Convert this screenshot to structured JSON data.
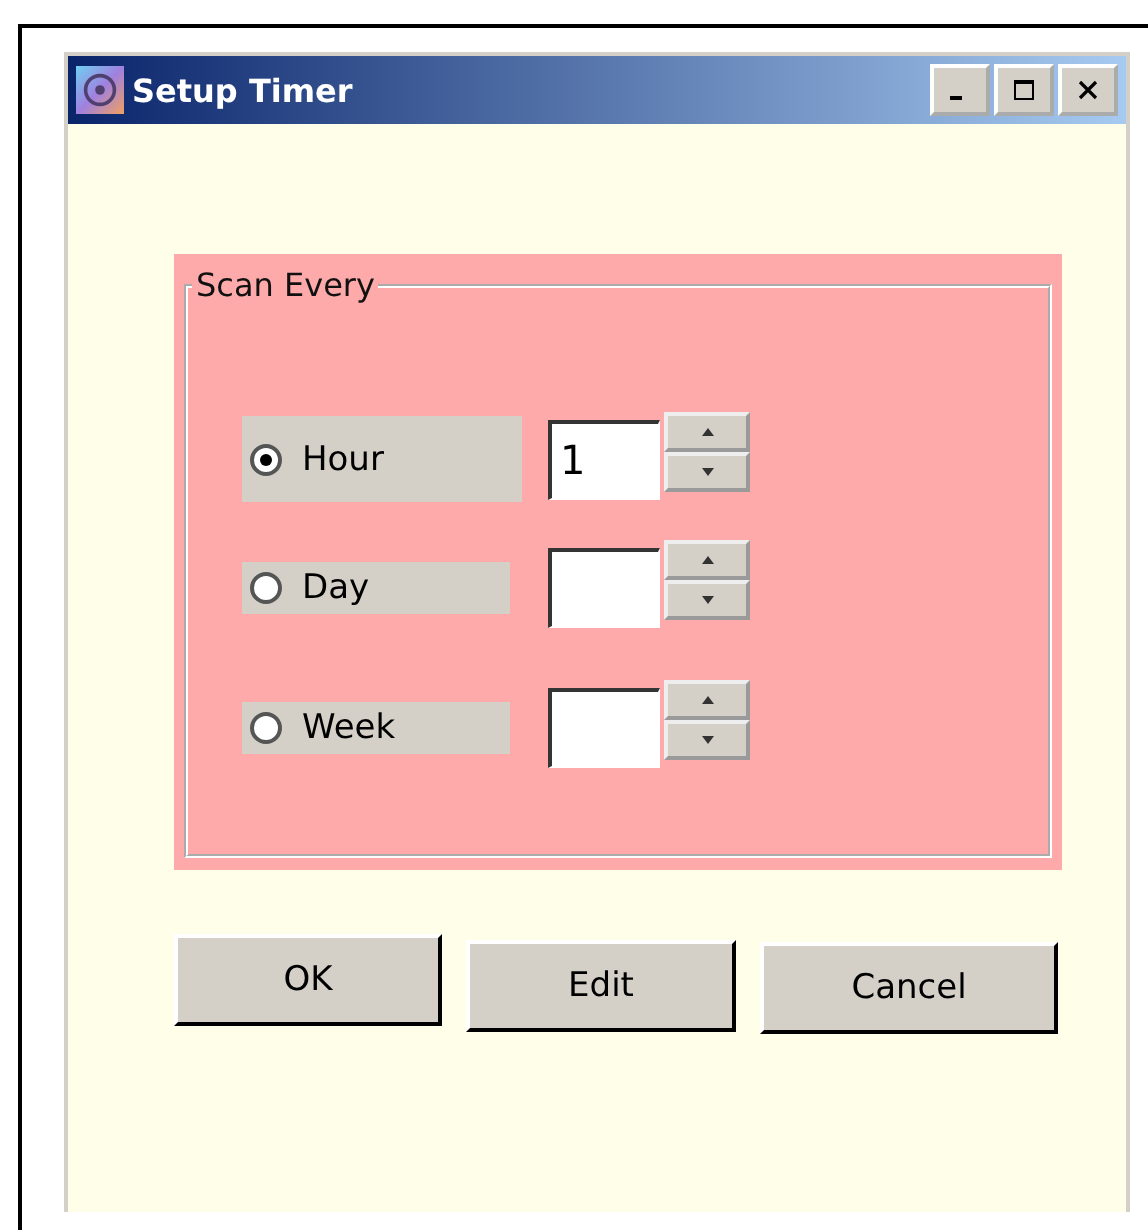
{
  "window": {
    "title": "Setup Timer"
  },
  "group": {
    "title": "Scan Every"
  },
  "options": [
    {
      "label": "Hour",
      "selected": true,
      "value": "1"
    },
    {
      "label": "Day",
      "selected": false
    },
    {
      "label": "Week",
      "selected": false
    }
  ],
  "buttons": [
    "OK",
    "Edit",
    "Cancel"
  ]
}
